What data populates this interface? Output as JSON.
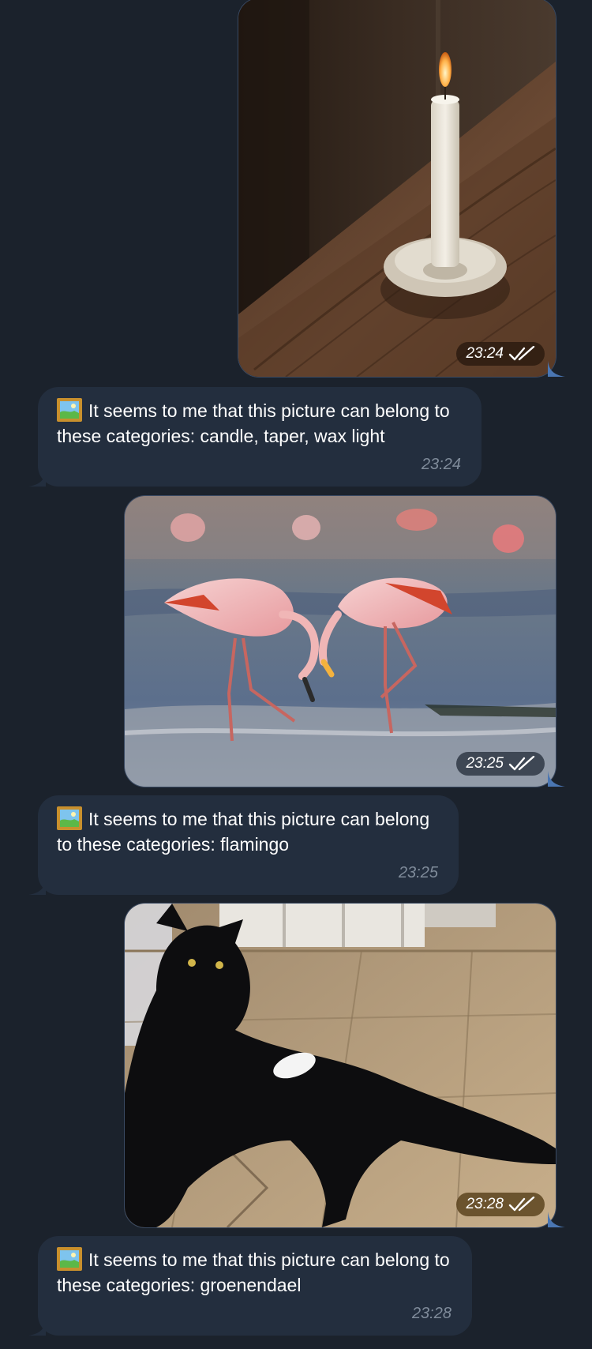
{
  "colors": {
    "background": "#1b222c",
    "incoming_bubble": "#232e3e",
    "outgoing_tail": "#4a76b2",
    "incoming_time": "#7f8b9a"
  },
  "messages": [
    {
      "kind": "photo",
      "subject": "candle",
      "time": "23:24",
      "status_icon": "double-check-icon"
    },
    {
      "kind": "text",
      "icon": "framed-picture-icon",
      "text": "It seems to me that this picture can belong to these categories: candle, taper, wax light",
      "time": "23:24"
    },
    {
      "kind": "photo",
      "subject": "flamingo",
      "time": "23:25",
      "status_icon": "double-check-icon"
    },
    {
      "kind": "text",
      "icon": "framed-picture-icon",
      "text": "It seems to me that this picture can belong to these categories: flamingo",
      "time": "23:25"
    },
    {
      "kind": "photo",
      "subject": "black cat",
      "time": "23:28",
      "status_icon": "double-check-icon"
    },
    {
      "kind": "text",
      "icon": "framed-picture-icon",
      "text": "It seems to me that this picture can belong to these categories: groenendael",
      "time": "23:28"
    }
  ]
}
